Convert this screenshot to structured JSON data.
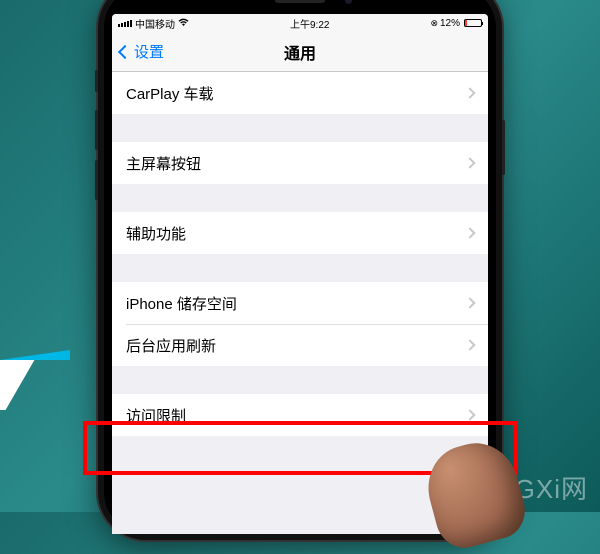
{
  "statusbar": {
    "carrier": "中国移动",
    "time": "上午9:22",
    "battery_pct": "12%"
  },
  "navbar": {
    "back_label": "设置",
    "title": "通用"
  },
  "cells": {
    "carplay": "CarPlay 车载",
    "home_button": "主屏幕按钮",
    "accessibility": "辅助功能",
    "storage": "iPhone 储存空间",
    "background_refresh": "后台应用刷新",
    "restrictions": "访问限制"
  },
  "watermark": "GXi网"
}
